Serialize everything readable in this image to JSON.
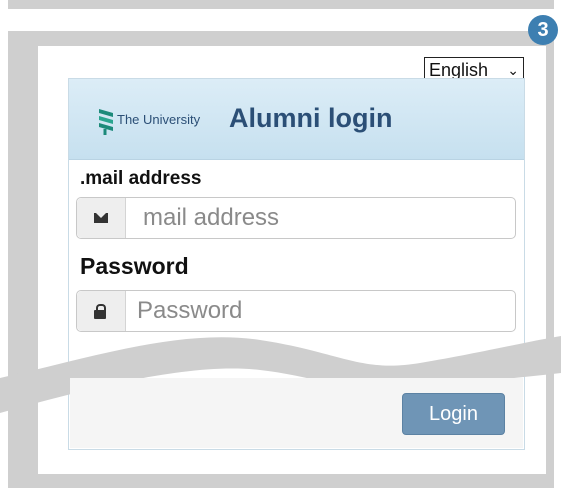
{
  "step_badge": "3",
  "language": {
    "selected": "English"
  },
  "header": {
    "logo_text": "The University",
    "title": "Alumni login"
  },
  "form": {
    "email_label": ".mail address",
    "email_placeholder": "mail address",
    "password_label": "Password",
    "password_placeholder": "Password",
    "login_button": "Login"
  },
  "colors": {
    "header_bg": "#c6e0ef",
    "title_color": "#2b4f76",
    "button_bg": "#6f95b6",
    "badge_bg": "#3d7fb1"
  },
  "icons": {
    "email": "envelope-icon",
    "password": "lock-icon",
    "logo": "university-logo",
    "dropdown": "chevron-down-icon"
  }
}
